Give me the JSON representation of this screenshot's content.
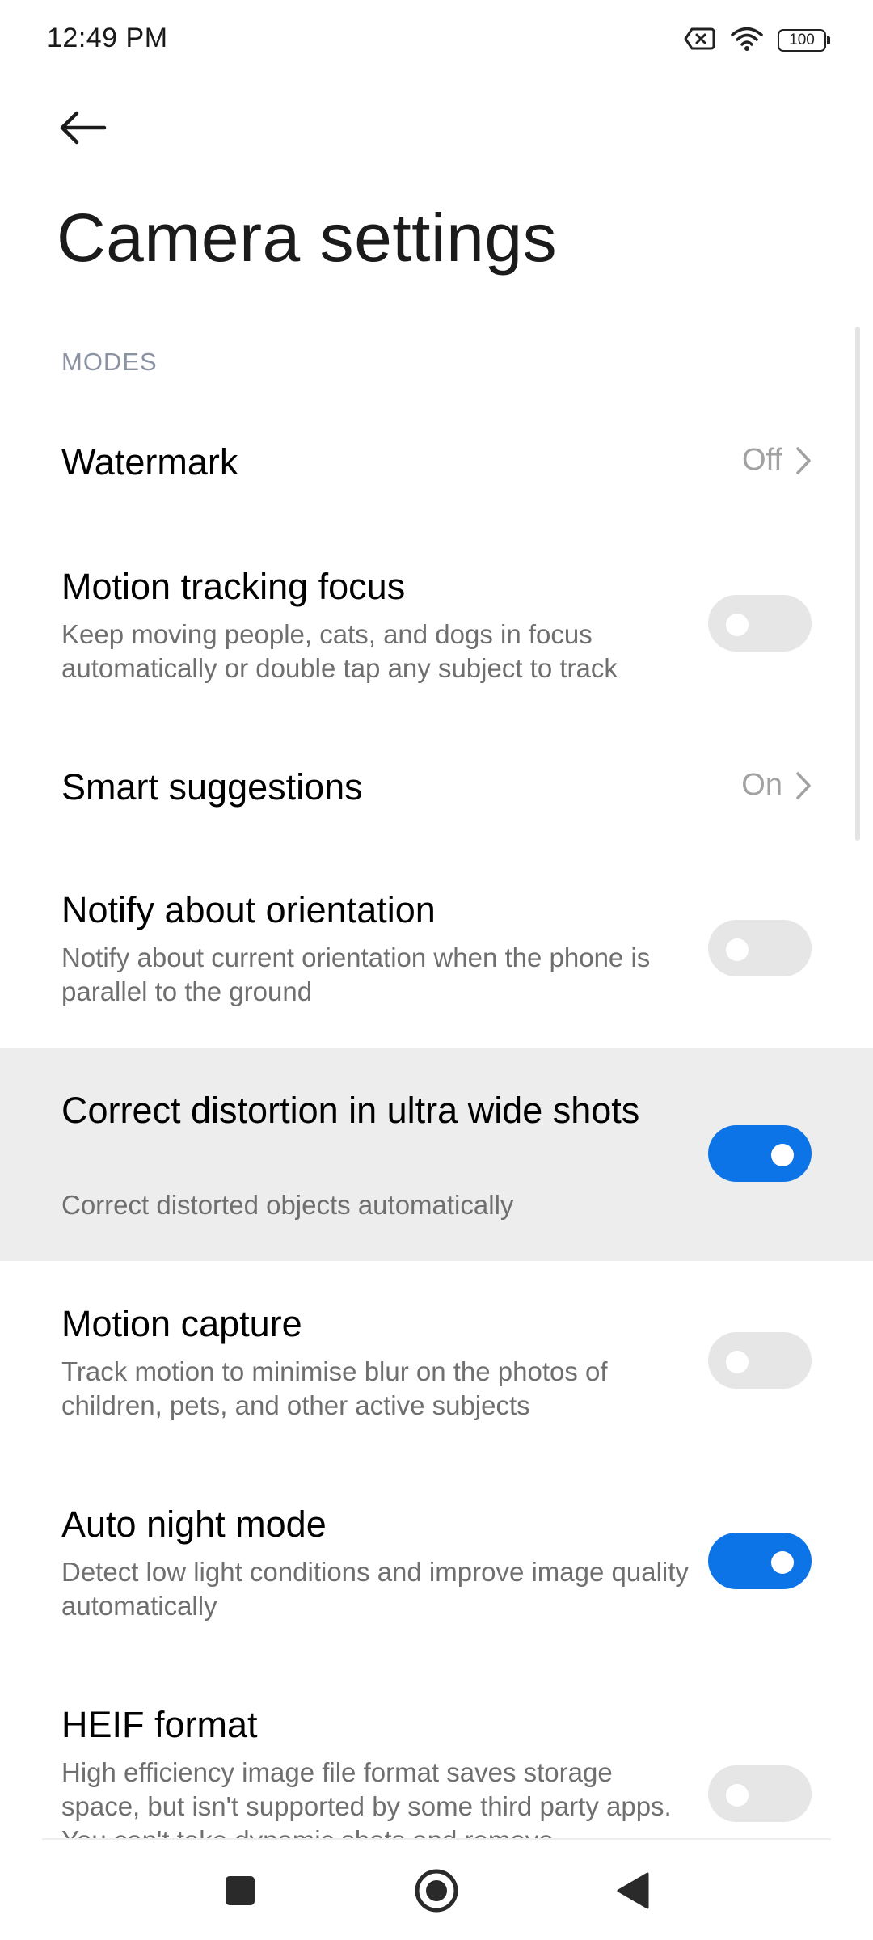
{
  "status_bar": {
    "time": "12:49 PM",
    "battery": "100",
    "icons": [
      "sim-x-icon",
      "wifi-icon",
      "battery-icon"
    ]
  },
  "header": {
    "back_icon": "arrow-left-icon",
    "title": "Camera settings"
  },
  "section": {
    "label": "MODES"
  },
  "settings": [
    {
      "title": "Watermark",
      "type": "link",
      "value": "Off"
    },
    {
      "title": "Motion tracking focus",
      "description": "Keep moving people, cats, and dogs in focus automatically or double tap any subject to track",
      "type": "toggle",
      "enabled": false
    },
    {
      "title": "Smart suggestions",
      "type": "link",
      "value": "On"
    },
    {
      "title": "Notify about orientation",
      "description": "Notify about current orientation when the phone is parallel to the ground",
      "type": "toggle",
      "enabled": false
    },
    {
      "title": "Correct distortion in ultra wide shots",
      "description": "Correct distorted objects automatically",
      "type": "toggle",
      "enabled": true,
      "highlighted": true
    },
    {
      "title": "Motion capture",
      "description": "Track motion to minimise blur on the photos of children, pets, and other active subjects",
      "type": "toggle",
      "enabled": false
    },
    {
      "title": "Auto night mode",
      "description": "Detect low light conditions and improve image quality automatically",
      "type": "toggle",
      "enabled": true
    },
    {
      "title": "HEIF format",
      "description": "High efficiency image file format saves storage space, but isn't supported by some third party apps. You can't take dynamic shots and remove",
      "type": "toggle",
      "enabled": false
    }
  ],
  "nav_bar": {
    "icons": [
      "recents-square-icon",
      "home-circle-icon",
      "back-triangle-icon"
    ]
  },
  "colors": {
    "accent": "#0d74e8",
    "toggle_off": "#e6e6e6",
    "highlight_bg": "#ededed",
    "section_label": "#8b93a3",
    "secondary_text": "#6f6f6f"
  }
}
